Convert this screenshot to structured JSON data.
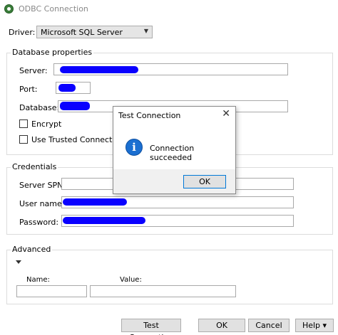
{
  "window": {
    "title": "ODBC Connection"
  },
  "driver": {
    "label": "Driver:",
    "value": "Microsoft SQL Server"
  },
  "database_properties": {
    "title": "Database properties",
    "server_label": "Server:",
    "port_label": "Port:",
    "database_label": "Database:",
    "encrypt_label": "Encrypt",
    "trusted_label": "Use Trusted Connection"
  },
  "credentials": {
    "title": "Credentials",
    "spn_label": "Server SPN:",
    "username_label": "User name:",
    "password_label": "Password:"
  },
  "advanced": {
    "title": "Advanced",
    "name_label": "Name:",
    "value_label": "Value:"
  },
  "buttons": {
    "test_connection": "Test Connection",
    "ok": "OK",
    "cancel": "Cancel",
    "help": "Help",
    "help_arrow": "▾"
  },
  "dialog": {
    "title": "Test Connection",
    "close": "✕",
    "icon_glyph": "i",
    "message": "Connection succeeded",
    "ok": "OK"
  },
  "colors": {
    "redaction": "#0a00ff",
    "accent": "#0078d7"
  }
}
